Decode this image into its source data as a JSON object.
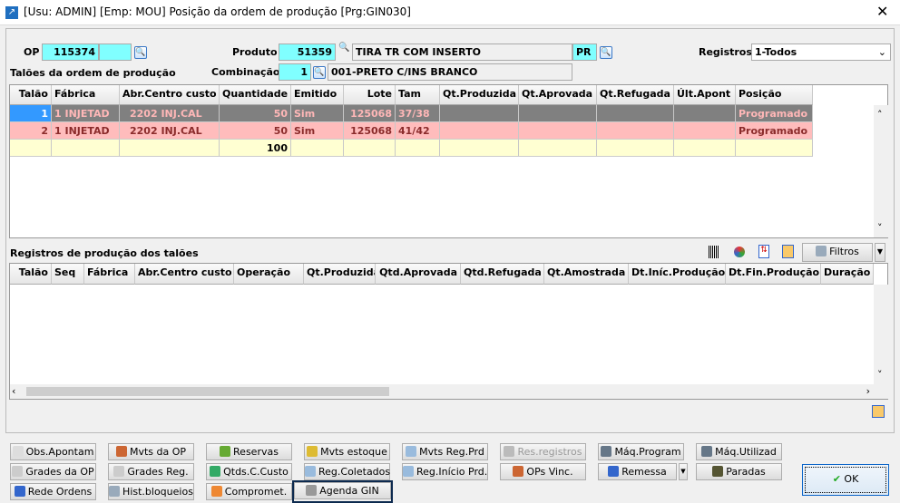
{
  "window": {
    "title": "[Usu: ADMIN] [Emp: MOU] Posição da ordem de produção [Prg:GIN030]",
    "close": "✕"
  },
  "form": {
    "op_label": "OP",
    "op_value": "115374",
    "op_extra": "",
    "produto_label": "Produto",
    "produto_code": "51359",
    "produto_desc": "TIRA TR COM INSERTO",
    "produto_suffix": "PR",
    "combinacao_label": "Combinação",
    "combinacao_code": "1",
    "combinacao_desc": "001-PRETO C/INS BRANCO",
    "registros_label": "Registros",
    "registros_value": "1-Todos"
  },
  "taloes": {
    "title": "Talões da ordem de produção",
    "columns": [
      "Talão",
      "Fábrica",
      "Abr.Centro custo",
      "Quantidade",
      "Emitido",
      "Lote",
      "Tam",
      "Qt.Produzida",
      "Qt.Aprovada",
      "Qt.Refugada",
      "Últ.Apont",
      "Posição"
    ],
    "rows": [
      [
        "1",
        "1 INJETAD",
        "2202 INJ.CAL",
        "50",
        "Sim",
        "125068",
        "37/38",
        "",
        "",
        "",
        "",
        "Programado"
      ],
      [
        "2",
        "1 INJETAD",
        "2202 INJ.CAL",
        "50",
        "Sim",
        "125068",
        "41/42",
        "",
        "",
        "",
        "",
        "Programado"
      ]
    ],
    "total": [
      "",
      "",
      "",
      "100",
      "",
      "",
      "",
      "",
      "",
      "",
      "",
      ""
    ]
  },
  "registros": {
    "title": "Registros de produção dos talões",
    "filtros": "Filtros",
    "columns": [
      "Talão",
      "Seq",
      "Fábrica",
      "Abr.Centro custo",
      "Operação",
      "Qt.Produzida",
      "Qtd.Aprovada",
      "Qtd.Refugada",
      "Qt.Amostrada",
      "Dt.Iníc.Produção",
      "Dt.Fin.Produção",
      "Duração"
    ]
  },
  "buttons": [
    [
      "Obs.Apontam",
      "Mvts da OP",
      "Reservas",
      "Mvts estoque",
      "Mvts Reg.Prd",
      "Res.registros",
      "Máq.Program",
      "Máq.Utilizad"
    ],
    [
      "Grades da OP",
      "Grades Reg.",
      "Qtds.C.Custo",
      "Reg.Coletados",
      "Reg.Início Prd.",
      "OPs Vinc.",
      "Remessa",
      "Paradas"
    ],
    [
      "Rede Ordens",
      "Hist.bloqueios",
      "Compromet.",
      "Agenda GIN"
    ]
  ],
  "ok": "OK"
}
